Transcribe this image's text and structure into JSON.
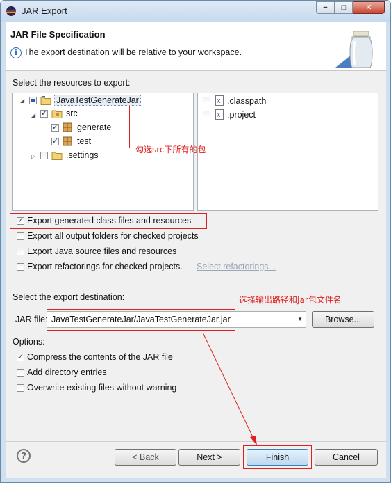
{
  "window": {
    "title": "JAR Export",
    "minimize": "−",
    "maximize": "□",
    "close": "✕"
  },
  "header": {
    "title": "JAR File Specification",
    "info_icon": "i",
    "description": "The export destination will be relative to your workspace."
  },
  "resources": {
    "label": "Select the resources to export:",
    "tree": [
      {
        "label": "JavaTestGenerateJar"
      },
      {
        "label": "src"
      },
      {
        "label": "generate"
      },
      {
        "label": "test"
      },
      {
        "label": ".settings"
      }
    ],
    "files": [
      {
        "label": ".classpath"
      },
      {
        "label": ".project"
      }
    ]
  },
  "options_export": {
    "generated": "Export generated class files and resources",
    "output_folders": "Export all output folders for checked projects",
    "source": "Export Java source files and resources",
    "refactorings": "Export refactorings for checked projects.",
    "select_refactorings": "Select refactorings..."
  },
  "destination": {
    "label": "Select the export destination:",
    "jar_file_label": "JAR file:",
    "jar_file_value": "JavaTestGenerateJar/JavaTestGenerateJar.jar",
    "browse": "Browse..."
  },
  "options": {
    "label": "Options:",
    "compress": "Compress the contents of the JAR file",
    "directory": "Add directory entries",
    "overwrite": "Overwrite existing files without warning"
  },
  "annotations": {
    "packages": "勾选src下所有的包",
    "output": "选择输出路径和Jar包文件名"
  },
  "buttons": {
    "help": "?",
    "back": "< Back",
    "next": "Next >",
    "finish": "Finish",
    "cancel": "Cancel"
  },
  "colors": {
    "annotation": "#e02020",
    "title_bar": "#cfe0f1"
  }
}
